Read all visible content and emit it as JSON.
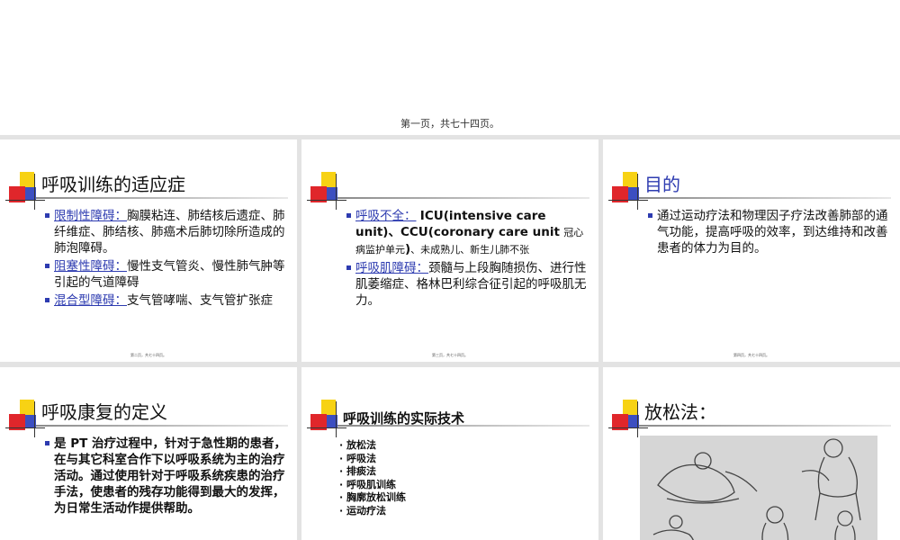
{
  "page_caption": "第一页，共七十四页。",
  "slides": [
    {
      "title": "呼吸训练的适应症",
      "items": [
        {
          "term": "限制性障碍：",
          "text": "胸膜粘连、肺结核后遗症、肺纤维症、肺结核、肺癌术后肺切除所造成的肺泡障碍。"
        },
        {
          "term": "阻塞性障碍：",
          "text": "慢性支气管炎、慢性肺气肿等引起的气道障碍"
        },
        {
          "term": "混合型障碍：",
          "text": "支气管哮喘、支气管扩张症"
        }
      ],
      "footer": "第二页，共七十四页。"
    },
    {
      "title": "",
      "items": [
        {
          "term": "呼吸不全：",
          "text_bold": "ICU(intensive care unit)、CCU(coronary care unit",
          "text_small": "冠心病监护单元",
          "text_bold2": ")",
          "text_small2": "、未成熟儿、新生儿肺不张"
        },
        {
          "term": "呼吸肌障碍：",
          "text": "颈髓与上段胸随损伤、进行性肌萎缩症、格林巴利综合征引起的呼吸肌无力。"
        }
      ],
      "footer": "第三页，共七十四页。"
    },
    {
      "title": "目的",
      "items": [
        {
          "text": "通过运动疗法和物理因子疗法改善肺部的通气功能，提高呼吸的效率，到达维持和改善患者的体力为目的。"
        }
      ],
      "footer": "第四页，共七十四页。"
    },
    {
      "title": "呼吸康复的定义",
      "items": [
        {
          "text": "是 PT 治疗过程中，针对于急性期的患者，在与其它科室合作下以呼吸系统为主的治疗活动。通过使用针对于呼吸系统疾患的治疗手法，使患者的残存功能得到最大的发挥，为日常生活动作提供帮助。"
        }
      ]
    },
    {
      "title": "呼吸训练的实际技术",
      "list": [
        "· 放松法",
        "· 呼吸法",
        "· 排痰法",
        "· 呼吸肌训练",
        "· 胸廓放松训练",
        "· 运动疗法"
      ]
    },
    {
      "title": "放松法："
    }
  ]
}
